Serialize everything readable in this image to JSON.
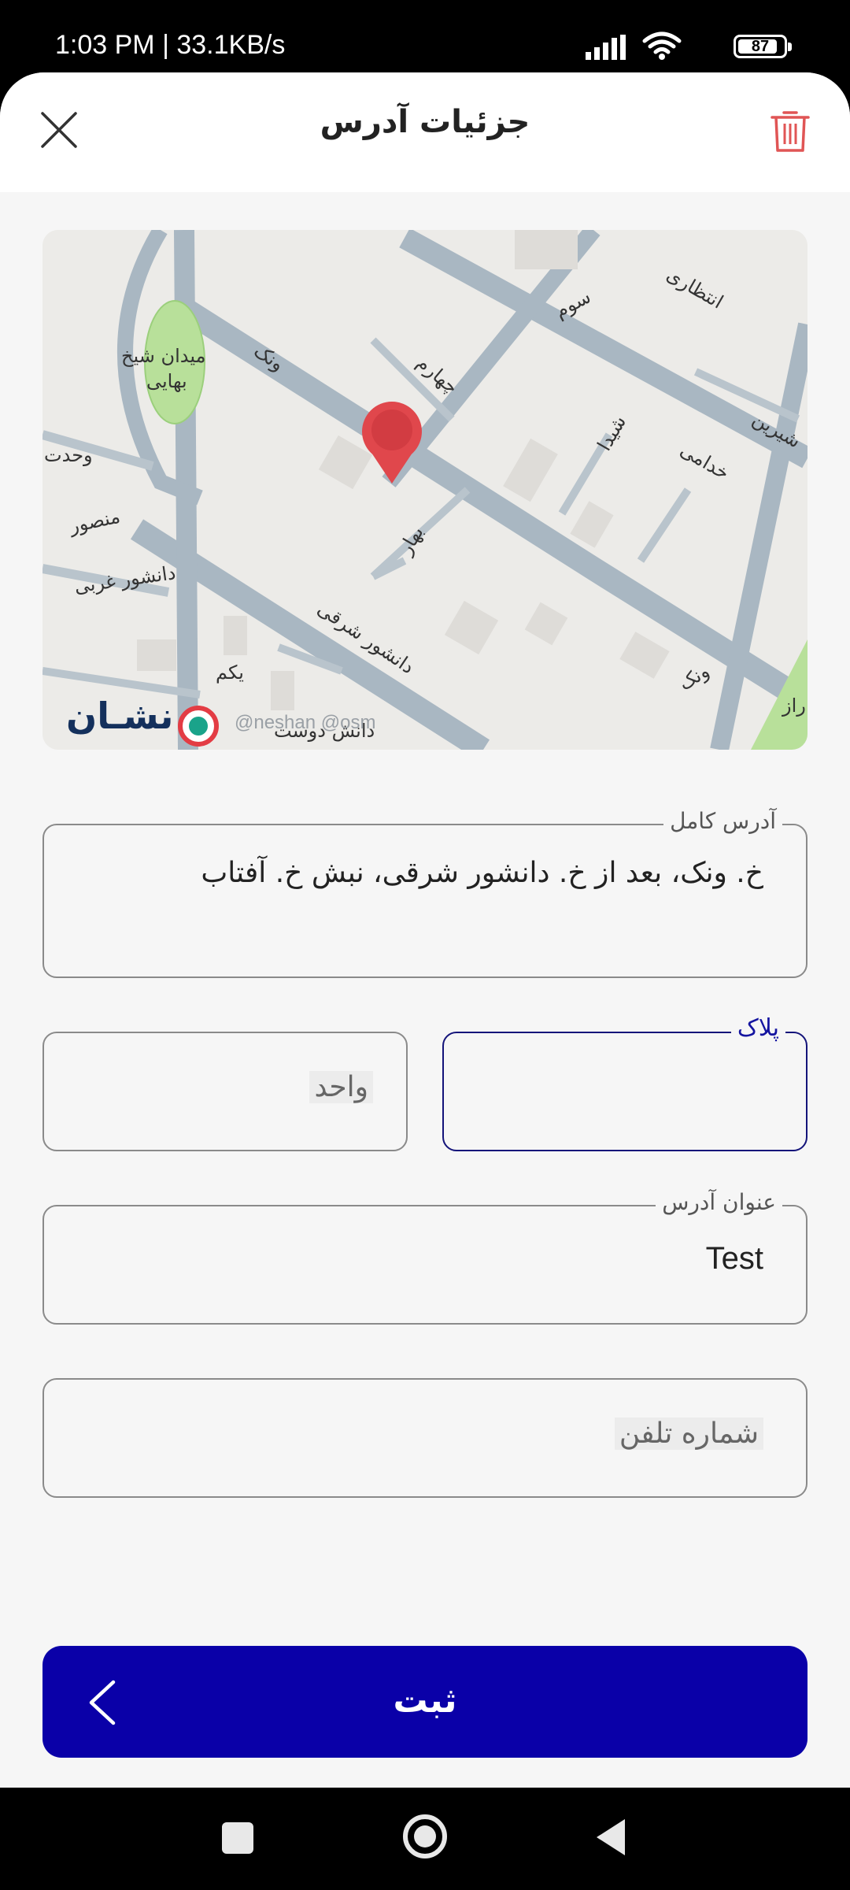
{
  "status_bar": {
    "time": "1:03 PM | 33.1KB/s",
    "battery_level": "87",
    "battery_fraction": 0.87
  },
  "header": {
    "title": "جزئیات آدرس",
    "close_icon": "close-icon",
    "delete_icon": "trash-icon",
    "delete_color": "#e05555"
  },
  "map": {
    "brand": "نشـان",
    "attribution": "@neshan @osm",
    "pin_icon": "map-pin-icon",
    "pin_color": "#e0474c",
    "labels": {
      "square": "میدان شیخ",
      "square2": "بهایی",
      "vanak1": "ونک",
      "vanak2": "ونک",
      "chaharom": "چهارم",
      "sevom": "سوم",
      "entezari": "انتظاری",
      "shirin": "شیرین",
      "khodami": "خدامی",
      "shayda": "شیدا",
      "bahar": "بهار",
      "vahdat": "وحدت",
      "mansour": "منصور",
      "daneshvar_gharbi": "دانشور غربی",
      "daneshvar_sharghi": "دانشور شرقی",
      "yekom": "یکم",
      "daneshdoost": "دانش دوست",
      "raz": "راز"
    }
  },
  "form": {
    "full_address": {
      "label": "آدرس کامل",
      "value": "خ. ونک، بعد از خ. دانشور شرقی، نبش خ. آفتاب"
    },
    "plaque": {
      "label": "پلاک",
      "value": ""
    },
    "unit": {
      "placeholder": "واحد"
    },
    "address_title": {
      "label": "عنوان آدرس",
      "value": "Test"
    },
    "phone": {
      "placeholder": "شماره تلفن"
    }
  },
  "submit": {
    "label": "ثبت",
    "arrow_icon": "chevron-left-icon",
    "color": "#0a00a8"
  },
  "nav_bar": {
    "recent_icon": "recent-apps-icon",
    "home_icon": "home-icon",
    "back_icon": "back-icon"
  }
}
